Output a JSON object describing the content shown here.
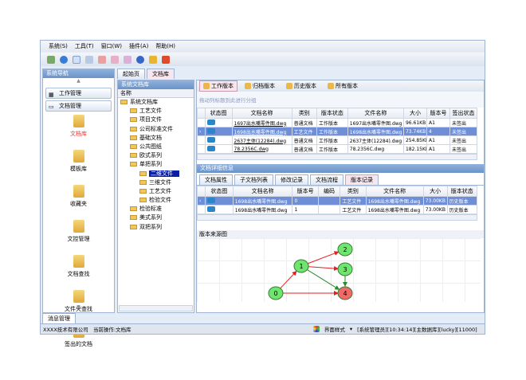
{
  "menu": [
    "系统(S)",
    "工具(T)",
    "窗口(W)",
    "插件(A)",
    "帮助(H)"
  ],
  "nav": {
    "title": "系统导航",
    "groups": [
      "工作管理",
      "文档管理"
    ],
    "items": [
      "文档库",
      "模板库",
      "收藏夹",
      "文控管理",
      "文档查找",
      "文件夹查找",
      "签出的文档"
    ]
  },
  "tabs": [
    "起始页",
    "文档库"
  ],
  "tree": {
    "title": "系统文档库",
    "header": "名称",
    "nodes": [
      {
        "label": "系统文档库",
        "level": 0
      },
      {
        "label": "工艺文件",
        "level": 1
      },
      {
        "label": "项目文件",
        "level": 1
      },
      {
        "label": "公司标准文件",
        "level": 1
      },
      {
        "label": "基础文档",
        "level": 1
      },
      {
        "label": "公共图纸",
        "level": 1
      },
      {
        "label": "欧式系列",
        "level": 1
      },
      {
        "label": "单把系列",
        "level": 1
      },
      {
        "label": "二维文件",
        "level": 2,
        "selected": true
      },
      {
        "label": "三维文件",
        "level": 2
      },
      {
        "label": "工艺文件",
        "level": 2
      },
      {
        "label": "检验文件",
        "level": 2
      },
      {
        "label": "检验标准",
        "level": 1
      },
      {
        "label": "美式系列",
        "level": 1
      },
      {
        "label": "双把系列",
        "level": 1
      }
    ]
  },
  "version_toolbar": [
    "工作版本",
    "归档版本",
    "历史版本",
    "所有版本"
  ],
  "group_hint": "拖动列标题到此进行分组",
  "doc_grid": {
    "columns": [
      "状态图",
      "文档名称",
      "类别",
      "版本状态",
      "文件名称",
      "大小",
      "版本号",
      "签出状态"
    ],
    "rows": [
      [
        "",
        "1697出水嘴零件图.dwg",
        "普通文档",
        "工作版本",
        "1697出水嘴零件图.dwg",
        "96.61KB",
        "A1",
        "未签出"
      ],
      [
        "",
        "1698出水嘴零件图.dwg",
        "工艺文件",
        "工作版本",
        "1698出水嘴零件图.dwg",
        "73.74KB",
        "4",
        "未签出"
      ],
      [
        "",
        "2637主体(12284).dwg",
        "普通文档",
        "工作版本",
        "2637主体(12284).dwg",
        "254.85KB",
        "A1",
        "未签出"
      ],
      [
        "",
        "78.2356C.dwg",
        "普通文档",
        "工作版本",
        "78.2356C.dwg",
        "182.15KB",
        "A1",
        "未签出"
      ]
    ],
    "selected": 1
  },
  "detail": {
    "title": "文档详细信息",
    "tabs": [
      "文档属性",
      "子文档列表",
      "修改记录",
      "文档流程",
      "版本记录"
    ],
    "active_tab": 4,
    "columns": [
      "状态图",
      "文档名称",
      "版本号",
      "编码",
      "类别",
      "文件名称",
      "大小",
      "版本状态"
    ],
    "rows": [
      [
        "",
        "1698出水嘴零件图.dwg",
        "0",
        "",
        "工艺文件",
        "1698出水嘴零件图.dwg",
        "73.00KB",
        "历史版本"
      ],
      [
        "",
        "1698出水嘴零件图.dwg",
        "1",
        "",
        "工艺文件",
        "1698出水嘴零件图.dwg",
        "73.00KB",
        "历史版本"
      ]
    ]
  },
  "graph": {
    "title": "版本来源图",
    "nodes": [
      "0",
      "1",
      "2",
      "3",
      "4"
    ],
    "edges": [
      [
        "0",
        "1",
        "#e02020"
      ],
      [
        "0",
        "4",
        "#e02020"
      ],
      [
        "1",
        "2",
        "#e02020"
      ],
      [
        "1",
        "3",
        "#e02020"
      ],
      [
        "1",
        "4",
        "#2a8a2a"
      ],
      [
        "3",
        "4",
        "#2a8a2a"
      ]
    ],
    "highlight": "4"
  },
  "bottom_tab": "消息管理",
  "status": {
    "company": "XXXX技术有限公司",
    "operation": "当前操作:文档库",
    "style": "界面样式",
    "info": "[系统管理员][10:34:14][主数据库][lucky][11000]"
  }
}
